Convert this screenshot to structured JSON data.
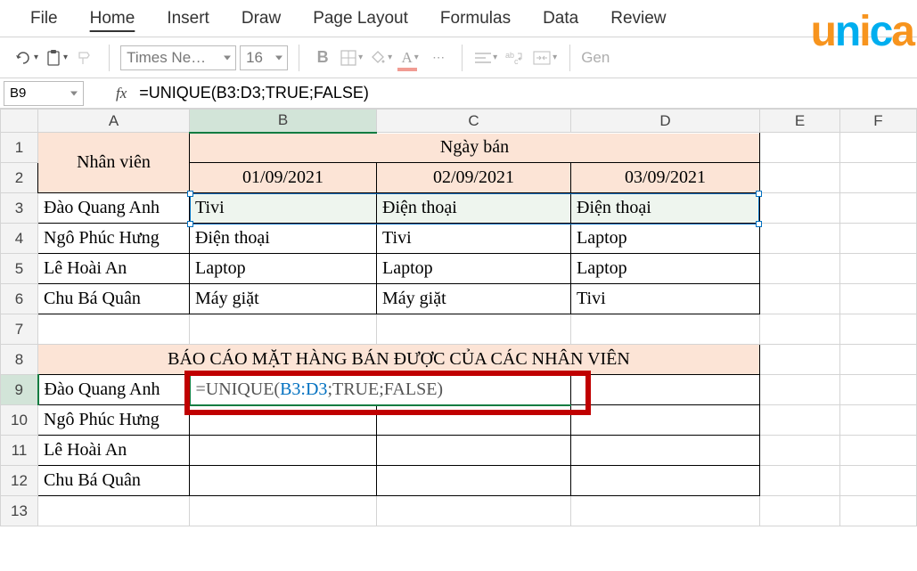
{
  "ribbon": {
    "tabs": [
      "File",
      "Home",
      "Insert",
      "Draw",
      "Page Layout",
      "Formulas",
      "Data",
      "Review"
    ],
    "active": 1
  },
  "toolbar": {
    "font_name": "Times Ne…",
    "font_size": "16",
    "general_label": "Gen"
  },
  "name_box": "B9",
  "fx_label": "fx",
  "formula": "=UNIQUE(B3:D3;TRUE;FALSE)",
  "columns": [
    "A",
    "B",
    "C",
    "D",
    "E",
    "F"
  ],
  "rows": [
    "1",
    "2",
    "3",
    "4",
    "5",
    "6",
    "7",
    "8",
    "9",
    "10",
    "11",
    "12",
    "13"
  ],
  "headers": {
    "nhan_vien": "Nhân viên",
    "ngay_ban": "Ngày bán",
    "dates": [
      "01/09/2021",
      "02/09/2021",
      "03/09/2021"
    ]
  },
  "staff": [
    "Đào Quang Anh",
    "Ngô Phúc Hưng",
    "Lê Hoài An",
    "Chu Bá Quân"
  ],
  "sales": [
    [
      "Tivi",
      "Điện thoại",
      "Điện thoại"
    ],
    [
      "Điện thoại",
      "Tivi",
      "Laptop"
    ],
    [
      "Laptop",
      "Laptop",
      "Laptop"
    ],
    [
      "Máy giặt",
      "Máy giặt",
      "Tivi"
    ]
  ],
  "report_title": "BÁO CÁO MẶT HÀNG BÁN ĐƯỢC CỦA CÁC NHÂN VIÊN",
  "report_staff": [
    "Đào Quang Anh",
    "Ngô Phúc Hưng",
    "Lê Hoài An",
    "Chu Bá Quân"
  ],
  "editing_cell": {
    "prefix": "=UNIQUE(",
    "range": "B3:D3",
    "suffix": ";TRUE;FALSE)"
  },
  "watermark": "unica"
}
